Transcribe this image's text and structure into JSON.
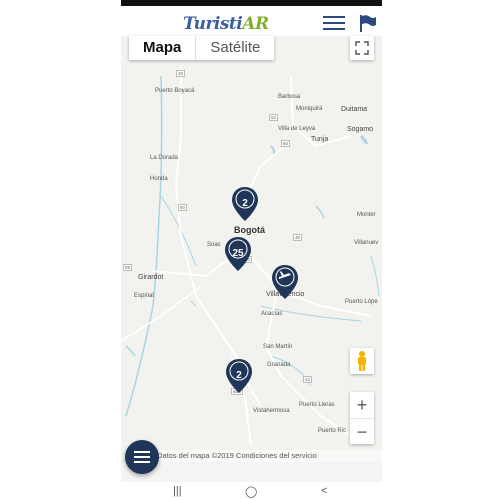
{
  "app": {
    "logo_part1": "Turisti",
    "logo_part2": "AR",
    "menu_icon": "hamburger-menu-icon",
    "flag_icon": "flag-icon"
  },
  "map": {
    "type_tabs": [
      "Mapa",
      "Satélite"
    ],
    "active_tab": "Mapa",
    "places": {
      "puerto_boyaca": "Puerto Boyacá",
      "barbosa": "Barbosa",
      "moniquira": "Moniquirá",
      "duitama": "Duitama",
      "sogamoso": "Sogamo",
      "villa_de_leyva": "Villa de Leyva",
      "tunja": "Tunja",
      "la_dorada": "La Dorada",
      "honda": "Honda",
      "bogota": "Bogotá",
      "soacha": "Soac",
      "montenegro": "Monter",
      "villanueva": "Villanuev",
      "girardot": "Girardot",
      "espinal": "Espinal",
      "villavicencio": "Villavicencio",
      "acacias": "Acacías",
      "puerto_lopez": "Puerto Lópe",
      "san_martin": "San Martín",
      "granada": "Granada",
      "puerto_lleras": "Puerto Lleras",
      "vistahermosa": "Vistahermosa",
      "puerto_rico": "Puerto Ric"
    },
    "road_shields": [
      "45",
      "62",
      "60",
      "50",
      "45",
      "40",
      "65",
      "43",
      "65A"
    ],
    "markers": [
      {
        "count": "2",
        "place": "Bogotá north"
      },
      {
        "count": "25",
        "place": "Bogotá"
      },
      {
        "count": "",
        "place": "Villavicencio",
        "icon": "airport-icon"
      },
      {
        "count": "2",
        "place": "Granada"
      }
    ],
    "attribution": "Datos del mapa ©2019   Condiciones del servicio",
    "zoom_in": "+",
    "zoom_out": "−"
  },
  "colors": {
    "marker": "#1f3658",
    "water": "#a6d6e4",
    "road": "#ffffff",
    "logo_blue": "#3a5fa0",
    "logo_green": "#7fae2d"
  },
  "navbar": {
    "recents": "|||",
    "home": "◯",
    "back": "<"
  }
}
